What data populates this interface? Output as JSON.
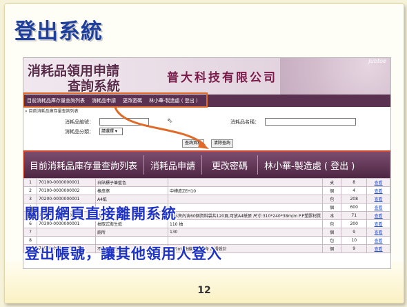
{
  "slide": {
    "title": "登出系統",
    "page_number": "12"
  },
  "app": {
    "system_title_line1": "消耗品領用申請",
    "system_title_line2": "查詢系統",
    "company": "普大科技有限公司",
    "header_brand": "Jubtoe"
  },
  "nav": {
    "items": [
      "目前消耗品庫存量查詢列表",
      "消耗品申請",
      "更改密碼",
      "林小華-製造處 ( 登出 )"
    ]
  },
  "breadcrumb": "» 目前消耗品庫存量查詢列表",
  "search": {
    "code_label": "消耗品編號：",
    "name_label": "消耗品名稱：",
    "category_label": "消耗品分類：",
    "category_selected": "請選擇",
    "query_button": "查詢資料",
    "clear_button": "清除查詢"
  },
  "table": {
    "rows": [
      {
        "no": "1",
        "code": "70100-0000000001",
        "name": "白貼標子筆藍色",
        "spec": "",
        "unit": "支",
        "stock": "8",
        "action": "查看"
      },
      {
        "no": "2",
        "code": "70100-0000000002",
        "name": "橡皮擦",
        "spec": "中樺皮ZEH10",
        "unit": "個",
        "stock": "4",
        "action": "查看"
      },
      {
        "no": "3",
        "code": "70200-0000000001",
        "name": "A4紙",
        "spec": "",
        "unit": "包",
        "stock": "208",
        "action": "查看"
      },
      {
        "no": "4",
        "code": "",
        "name": "",
        "spec": "",
        "unit": "個",
        "stock": "600",
        "action": "查看"
      },
      {
        "no": "5",
        "code": "70200-0000000003",
        "name": "資料夾",
        "spec": "資料夾內含60個資料袋共120頁,可放A4紙張 尺寸:310*240*38m/m P.P塑膠材質",
        "unit": "本",
        "stock": "71",
        "action": "查看"
      },
      {
        "no": "6",
        "code": "70300-0000000001",
        "name": "抽取式衛生紙",
        "spec": "110 抽",
        "unit": "包",
        "stock": "200",
        "action": "查看"
      },
      {
        "no": "7",
        "code": "",
        "name": "廁所",
        "spec": "130",
        "unit": "個",
        "stock": "9",
        "action": "查看"
      },
      {
        "no": "8",
        "code": "",
        "name": "",
        "spec": "",
        "unit": "包",
        "stock": "10",
        "action": "查看"
      },
      {
        "no": "9",
        "code": "70500-0000000001",
        "name": "不鏽鋼隔熱杯",
        "spec": "400ml 曲線造型瓶身 防滑設計",
        "unit": "個",
        "stock": "9",
        "action": "查看"
      }
    ]
  },
  "overlay": {
    "line1": "關閉網頁直接離開系統",
    "line2": "登出帳號，讓其他領用人登入"
  },
  "colors": {
    "title_blue": "#1f3f9c",
    "overlay_blue": "#1e33c4",
    "nav_purple": "#5a3150",
    "highlight_orange": "#e06a28",
    "highlight_red": "#d44a2a"
  }
}
